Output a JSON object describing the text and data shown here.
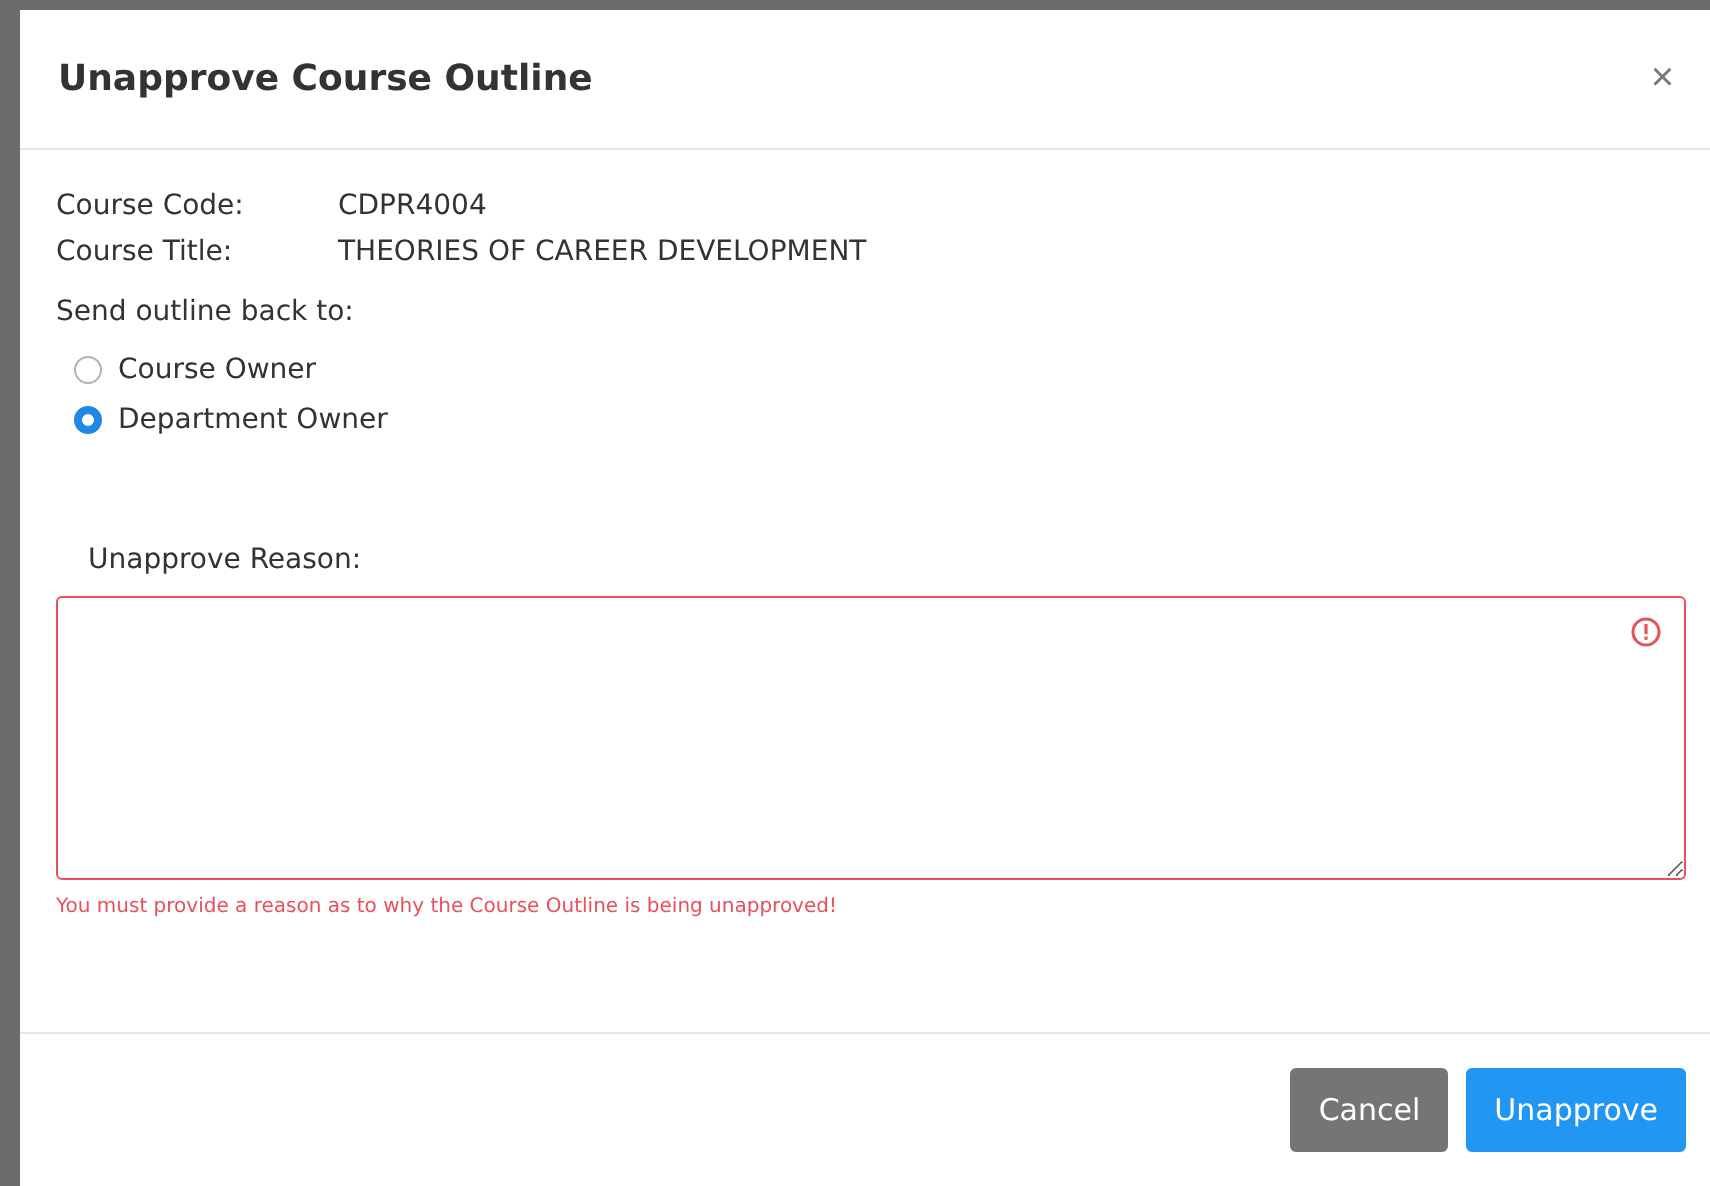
{
  "dialog": {
    "title": "Unapprove Course Outline",
    "close": "×"
  },
  "details": [
    {
      "label": "Course Code:",
      "value": "CDPR4004"
    },
    {
      "label": "Course Title:",
      "value": "THEORIES OF CAREER DEVELOPMENT"
    }
  ],
  "send_back": {
    "label": "Send outline back to:",
    "options": [
      {
        "label": "Course Owner",
        "selected": false
      },
      {
        "label": "Department Owner",
        "selected": true
      }
    ]
  },
  "reason": {
    "label": "Unapprove Reason:",
    "invalid": true,
    "error": "You must provide a reason as to why the Course Outline is being unapproved!"
  },
  "buttons": [
    {
      "label": "Cancel",
      "kind": "secondary"
    },
    {
      "label": "Unapprove",
      "kind": "primary"
    }
  ]
}
